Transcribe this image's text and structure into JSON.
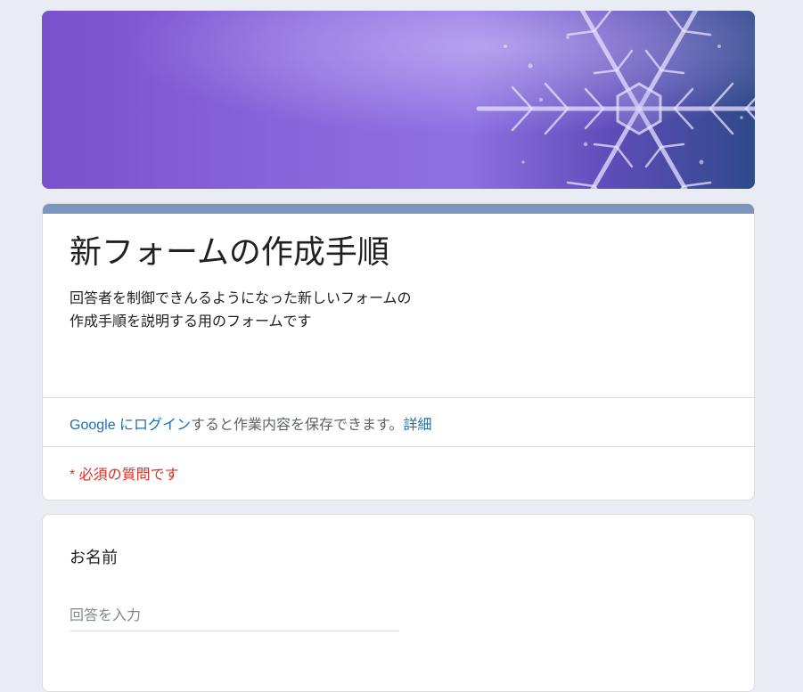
{
  "banner": {
    "image": "snowflake-banner"
  },
  "form": {
    "title": "新フォームの作成手順",
    "description_lines": [
      "回答者を制御できんるようになった新しいフォームの",
      "作成手順を説明する用のフォームです"
    ],
    "login": {
      "link_text": "Google にログイン",
      "suffix_text": "すると作業内容を保存できます。",
      "details_link": "詳細"
    },
    "required_note": "* 必須の質問です"
  },
  "question": {
    "title": "お名前",
    "input_placeholder": "回答を入力",
    "input_value": ""
  },
  "colors": {
    "background": "#eaecf4",
    "header_accent": "#7b95bd",
    "link": "#1a6fb8",
    "required": "#d93025"
  }
}
